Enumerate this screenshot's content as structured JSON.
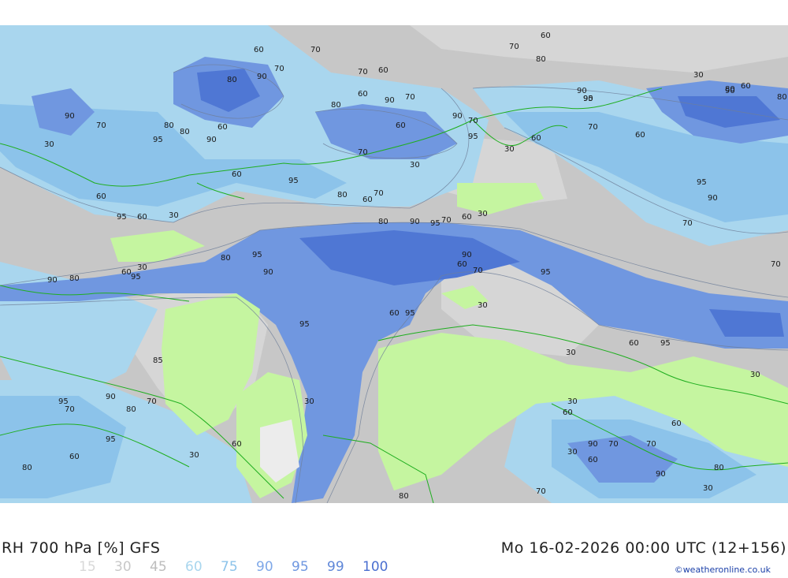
{
  "title_left": "RH 700 hPa [%] GFS",
  "title_right": "Mo 16-02-2026 00:00 UTC (12+156)",
  "credit": "©weatheronline.co.uk",
  "legend": [
    {
      "label": "15",
      "color": "#d8d8d8"
    },
    {
      "label": "30",
      "color": "#c8c8c8"
    },
    {
      "label": "45",
      "color": "#bdbdbd"
    },
    {
      "label": "60",
      "color": "#a9d6ee"
    },
    {
      "label": "75",
      "color": "#8cc3ea"
    },
    {
      "label": "90",
      "color": "#7fa8e8"
    },
    {
      "label": "95",
      "color": "#6f97e0"
    },
    {
      "label": "99",
      "color": "#5f87d8"
    },
    {
      "label": "100",
      "color": "#4a6fd0"
    }
  ],
  "contour_labels": [
    "60",
    "70",
    "80",
    "30",
    "90",
    "60",
    "70",
    "80",
    "90",
    "70",
    "60",
    "70",
    "80",
    "60",
    "90",
    "80",
    "90",
    "70",
    "80",
    "90",
    "60",
    "95",
    "70",
    "60",
    "90",
    "60",
    "80",
    "70",
    "90",
    "60",
    "95",
    "30",
    "70",
    "95",
    "60",
    "70",
    "95",
    "30",
    "90",
    "30",
    "60",
    "95",
    "90",
    "60",
    "30",
    "80",
    "60",
    "70",
    "80",
    "95",
    "60",
    "90",
    "95",
    "70",
    "60",
    "30",
    "80",
    "70",
    "70",
    "95",
    "90",
    "60",
    "70",
    "95",
    "80",
    "95",
    "80",
    "90",
    "60",
    "95",
    "90",
    "95",
    "30",
    "30",
    "95",
    "85",
    "30",
    "60",
    "30",
    "30",
    "90",
    "95",
    "70",
    "80",
    "70",
    "95",
    "60",
    "30",
    "60",
    "90",
    "70",
    "70",
    "80",
    "60",
    "90",
    "30",
    "60",
    "30",
    "80",
    "70",
    "60",
    "30",
    "60",
    "80",
    "30"
  ]
}
